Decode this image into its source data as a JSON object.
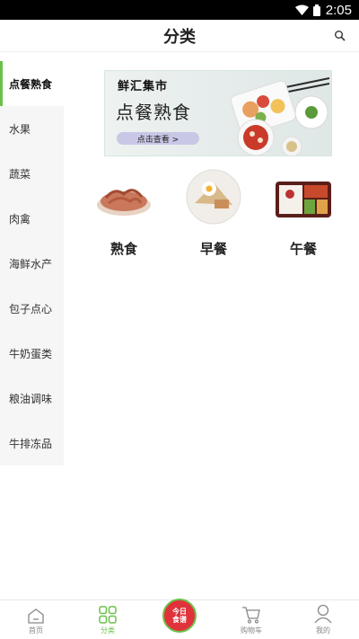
{
  "status_bar": {
    "time": "2:05"
  },
  "header": {
    "title": "分类"
  },
  "sidebar": {
    "items": [
      {
        "label": "点餐熟食",
        "active": true
      },
      {
        "label": "水果"
      },
      {
        "label": "蔬菜"
      },
      {
        "label": "肉禽"
      },
      {
        "label": "海鲜水产"
      },
      {
        "label": "包子点心"
      },
      {
        "label": "牛奶蛋类"
      },
      {
        "label": "粮油调味"
      },
      {
        "label": "牛排冻品"
      }
    ]
  },
  "banner": {
    "brand": "鲜汇集市",
    "title": "点餐熟食",
    "cta": "点击查看 >"
  },
  "categories": [
    {
      "label": "熟食"
    },
    {
      "label": "早餐"
    },
    {
      "label": "午餐"
    }
  ],
  "tabbar": {
    "items": [
      {
        "label": "首页"
      },
      {
        "label": "分类",
        "active": true
      },
      {
        "label": ""
      },
      {
        "label": "购物车"
      },
      {
        "label": "我的"
      }
    ],
    "center_badge": {
      "line1": "今日",
      "line2": "食谱"
    }
  },
  "colors": {
    "accent": "#6cc04a",
    "badge": "#e0323a"
  }
}
